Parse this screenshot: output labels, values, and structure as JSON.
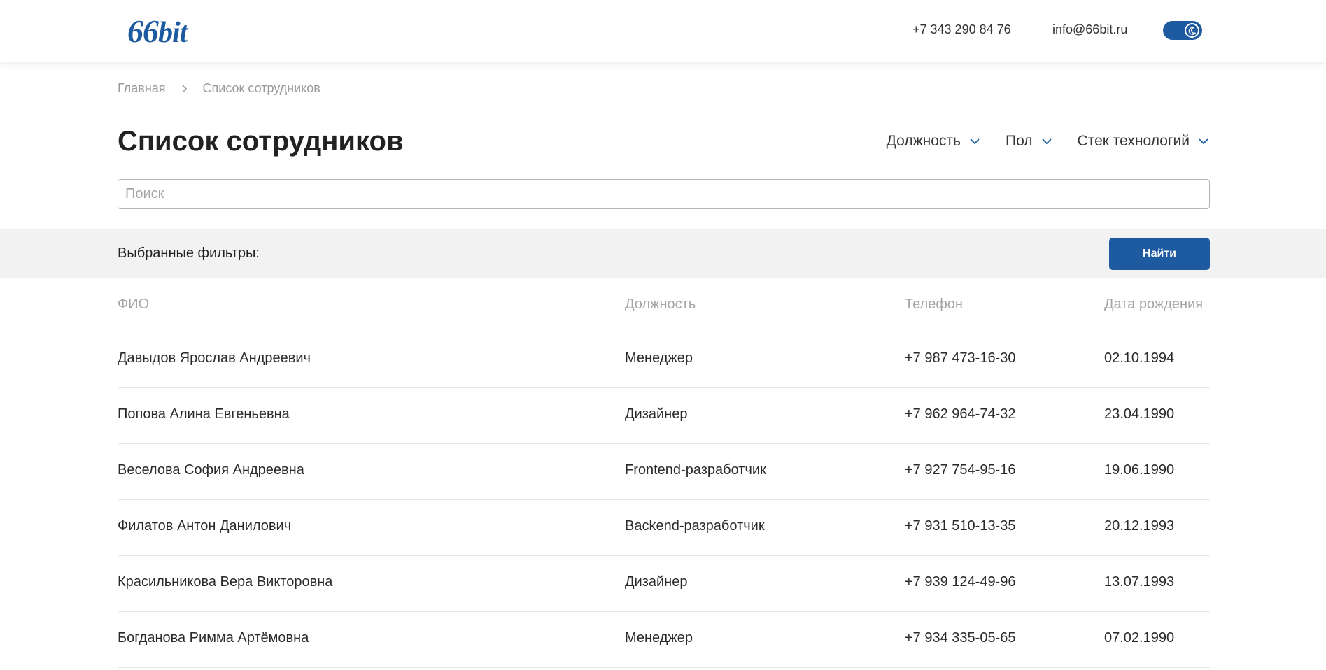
{
  "header": {
    "logo": {
      "big": "66",
      "small": "bit"
    },
    "phone": "+7 343 290 84 76",
    "email": "info@66bit.ru",
    "theme_toggle_icon": "moon-icon"
  },
  "breadcrumb": {
    "home": "Главная",
    "current": "Список сотрудников",
    "separator_icon": "chevron-right-icon"
  },
  "page_title": "Список сотрудников",
  "filters": [
    {
      "label": "Должность",
      "icon": "chevron-down-icon"
    },
    {
      "label": "Пол",
      "icon": "chevron-down-icon"
    },
    {
      "label": "Стек технологий",
      "icon": "chevron-down-icon"
    }
  ],
  "search": {
    "placeholder": "Поиск",
    "value": ""
  },
  "filter_bar": {
    "label": "Выбранные фильтры:",
    "button": "Найти"
  },
  "table": {
    "columns": [
      "ФИО",
      "Должность",
      "Телефон",
      "Дата рождения"
    ],
    "rows": [
      {
        "name": "Давыдов Ярослав Андреевич",
        "position": "Менеджер",
        "phone": "+7 987 473-16-30",
        "birth": "02.10.1994"
      },
      {
        "name": "Попова Алина Евгеньевна",
        "position": "Дизайнер",
        "phone": "+7 962 964-74-32",
        "birth": "23.04.1990"
      },
      {
        "name": "Веселова София Андреевна",
        "position": "Frontend-разработчик",
        "phone": "+7 927 754-95-16",
        "birth": "19.06.1990"
      },
      {
        "name": "Филатов Антон Данилович",
        "position": "Backend-разработчик",
        "phone": "+7 931 510-13-35",
        "birth": "20.12.1993"
      },
      {
        "name": "Красильникова Вера Викторовна",
        "position": "Дизайнер",
        "phone": "+7 939 124-49-96",
        "birth": "13.07.1993"
      },
      {
        "name": "Богданова Римма Артёмовна",
        "position": "Менеджер",
        "phone": "+7 934 335-05-65",
        "birth": "07.02.1990"
      }
    ]
  },
  "colors": {
    "accent": "#1d5aa0",
    "muted": "#a5a5a5",
    "filter_bar_bg": "#f2f2f2"
  }
}
